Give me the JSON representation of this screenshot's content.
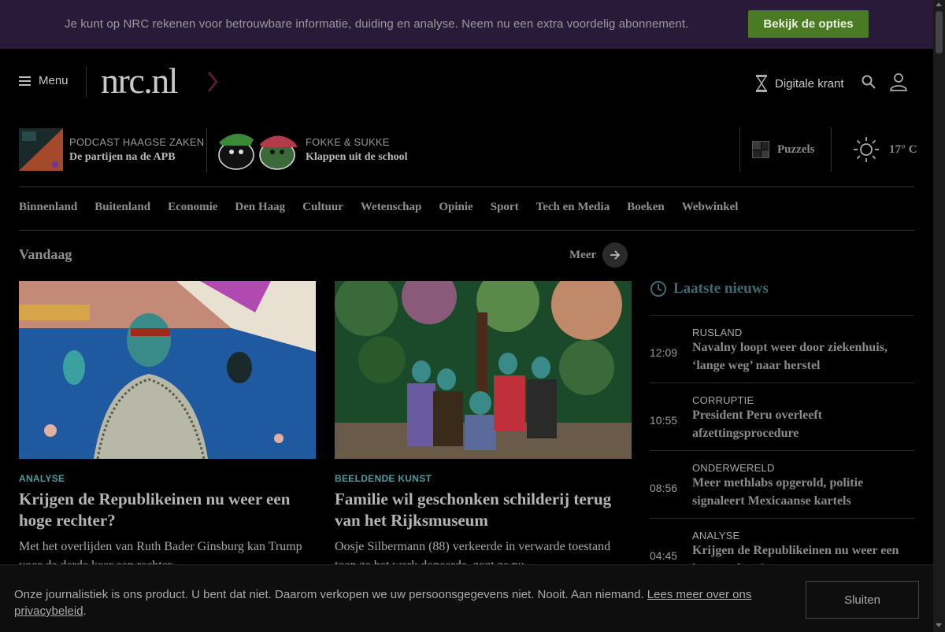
{
  "promo": {
    "text": "Je kunt op NRC rekenen voor betrouwbare informatie, duiding en analyse. Neem nu een extra voordelig abonnement.",
    "button_label": "Bekijk de opties"
  },
  "header": {
    "menu_label": "Menu",
    "logo_text": "nrc.nl",
    "digitale_krant_label": "Digitale krant"
  },
  "featured": [
    {
      "kicker": "PODCAST HAAGSE ZAKEN",
      "title": "De partijen na de APB",
      "thumb_icon": "podcast-cover-icon"
    },
    {
      "kicker": "FOKKE & SUKKE",
      "title": "Klappen uit de school",
      "thumb_icon": "fokke-sukke-icon"
    }
  ],
  "puzzels_label": "Puzzels",
  "weather": {
    "temp": "17° C",
    "icon": "sun-icon"
  },
  "nav": [
    "Binnenland",
    "Buitenland",
    "Economie",
    "Den Haag",
    "Cultuur",
    "Wetenschap",
    "Opinie",
    "Sport",
    "Tech en Media",
    "Boeken",
    "Webwinkel"
  ],
  "vandaag": {
    "title": "Vandaag",
    "more_label": "Meer"
  },
  "articles": [
    {
      "kicker": "ANALYSE",
      "title": "Krijgen de Republikeinen nu weer een hoge rechter?",
      "lead": "Met het overlijden van Ruth Bader Ginsburg kan Trump voor de derde keer een rechter"
    },
    {
      "kicker": "BEELDENDE KUNST",
      "title": "Familie wil geschonken schilderij terug van het Rijksmuseum",
      "lead": "Oosje Silbermann (88) verkeerde in verwarde toestand toen ze het werk doneerde, zegt ze nu"
    }
  ],
  "latest": {
    "title": "Laatste nieuws",
    "items": [
      {
        "time": "12:09",
        "kicker": "RUSLAND",
        "headline": "Navalny loopt weer door ziekenhuis, ‘lange weg’ naar herstel"
      },
      {
        "time": "10:55",
        "kicker": "CORRUPTIE",
        "headline": "President Peru overleeft afzettingsprocedure"
      },
      {
        "time": "08:56",
        "kicker": "ONDERWERELD",
        "headline": "Meer methlabs opgerold, politie signaleert Mexicaanse kartels"
      },
      {
        "time": "04:45",
        "kicker": "ANALYSE",
        "headline": "Krijgen de Republikeinen nu weer een hoge rechter?"
      }
    ]
  },
  "cookie": {
    "text": "Onze journalistiek is ons product. U bent dat niet. Daarom verkopen we uw persoonsgegevens niet. Nooit. Aan niemand. ",
    "link_label": "Lees meer over ons privacybeleid",
    "after_link": ".",
    "button_label": "Sluiten"
  },
  "colors": {
    "promo_bg": "#2a1a3a",
    "promo_button": "#4a7a24",
    "kicker": "#4d9a9a",
    "latest_title": "#3d6a70"
  }
}
